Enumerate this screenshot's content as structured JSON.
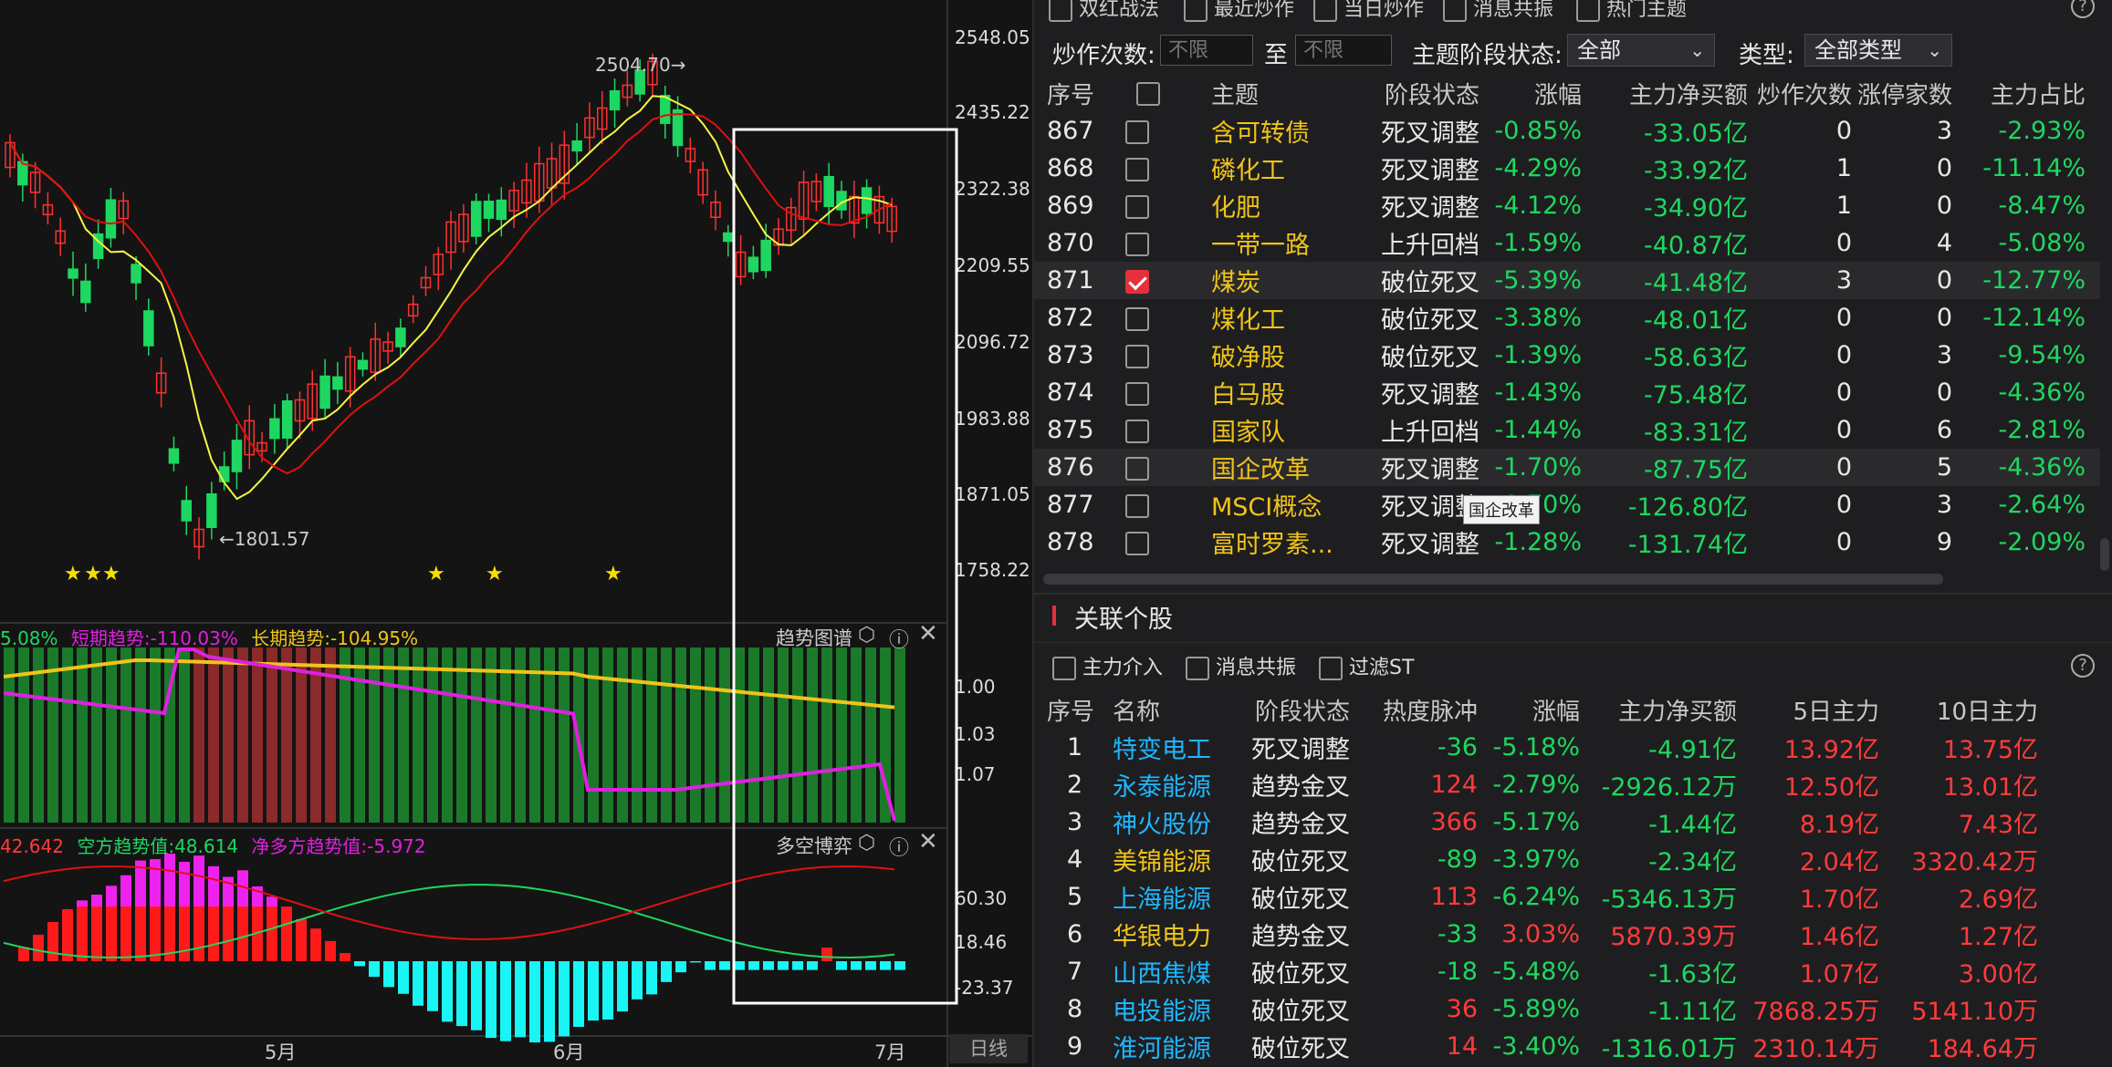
{
  "kchart": {
    "price_labels": [
      "2548.05",
      "2435.22",
      "2322.38",
      "2209.55",
      "2096.72",
      "1983.88",
      "1871.05",
      "1758.22"
    ],
    "high_annot": "2504.70",
    "low_annot": "1801.57",
    "month_labels": [
      "5月",
      "6月",
      "7月"
    ],
    "period_button": "日线"
  },
  "trend_panel": {
    "title": "趋势图谱",
    "legend_a": "5.08%",
    "legend_b": "短期趋势:-110.03%",
    "legend_c": "长期趋势:-104.95%",
    "axis_labels": [
      "1.00",
      "1.03",
      "1.07"
    ],
    "colors": {
      "short": "#e020e0",
      "long": "#f0c419",
      "bull": "#1b7a2a",
      "bear": "#8a2a2a"
    }
  },
  "bull_bear_panel": {
    "title": "多空博弈",
    "legend_a": "42.642",
    "legend_b": "空方趋势值:48.614",
    "legend_c": "净多方趋势值:-5.972",
    "axis_labels": [
      "60.30",
      "18.46",
      "-23.37"
    ]
  },
  "filters": {
    "top_items": [
      "双红战法",
      "最近炒作",
      "当日炒作",
      "消息共振",
      "热门主题"
    ],
    "count_label": "炒作次数:",
    "placeholder_from": "不限",
    "to_label": "至",
    "placeholder_to": "不限",
    "stage_label": "主题阶段状态:",
    "stage_value": "全部",
    "type_label": "类型:",
    "type_value": "全部类型"
  },
  "themes": {
    "headers": [
      "序号",
      "主题",
      "阶段状态",
      "涨幅",
      "主力净买额",
      "炒作次数",
      "涨停家数",
      "主力占比"
    ],
    "rows": [
      {
        "no": "867",
        "name": "含可转债",
        "stage": "死叉调整",
        "chg": "-0.85%",
        "net": "-33.05亿",
        "count": "0",
        "limit": "3",
        "ratio": "-2.93%",
        "checked": false
      },
      {
        "no": "868",
        "name": "磷化工",
        "stage": "死叉调整",
        "chg": "-4.29%",
        "net": "-33.92亿",
        "count": "1",
        "limit": "0",
        "ratio": "-11.14%",
        "checked": false
      },
      {
        "no": "869",
        "name": "化肥",
        "stage": "死叉调整",
        "chg": "-4.12%",
        "net": "-34.90亿",
        "count": "1",
        "limit": "0",
        "ratio": "-8.47%",
        "checked": false
      },
      {
        "no": "870",
        "name": "一带一路",
        "stage": "上升回档",
        "chg": "-1.59%",
        "net": "-40.87亿",
        "count": "0",
        "limit": "4",
        "ratio": "-5.08%",
        "checked": false
      },
      {
        "no": "871",
        "name": "煤炭",
        "stage": "破位死叉",
        "chg": "-5.39%",
        "net": "-41.48亿",
        "count": "3",
        "limit": "0",
        "ratio": "-12.77%",
        "checked": true
      },
      {
        "no": "872",
        "name": "煤化工",
        "stage": "破位死叉",
        "chg": "-3.38%",
        "net": "-48.01亿",
        "count": "0",
        "limit": "0",
        "ratio": "-12.14%",
        "checked": false
      },
      {
        "no": "873",
        "name": "破净股",
        "stage": "破位死叉",
        "chg": "-1.39%",
        "net": "-58.63亿",
        "count": "0",
        "limit": "3",
        "ratio": "-9.54%",
        "checked": false
      },
      {
        "no": "874",
        "name": "白马股",
        "stage": "死叉调整",
        "chg": "-1.43%",
        "net": "-75.48亿",
        "count": "0",
        "limit": "0",
        "ratio": "-4.36%",
        "checked": false
      },
      {
        "no": "875",
        "name": "国家队",
        "stage": "上升回档",
        "chg": "-1.44%",
        "net": "-83.31亿",
        "count": "0",
        "limit": "6",
        "ratio": "-2.81%",
        "checked": false
      },
      {
        "no": "876",
        "name": "国企改革",
        "stage": "死叉调整",
        "chg": "-1.70%",
        "net": "-87.75亿",
        "count": "0",
        "limit": "5",
        "ratio": "-4.36%",
        "checked": false
      },
      {
        "no": "877",
        "name": "MSCI概念",
        "stage": "死叉调整",
        "chg": "-1.70%",
        "net": "-126.80亿",
        "count": "0",
        "limit": "3",
        "ratio": "-2.64%",
        "checked": false
      },
      {
        "no": "878",
        "name": "富时罗素...",
        "stage": "死叉调整",
        "chg": "-1.28%",
        "net": "-131.74亿",
        "count": "0",
        "limit": "9",
        "ratio": "-2.09%",
        "checked": false
      }
    ],
    "tooltip": "国企改革"
  },
  "stocks": {
    "title": "关联个股",
    "filters": [
      "主力介入",
      "消息共振",
      "过滤ST"
    ],
    "headers": [
      "序号",
      "名称",
      "阶段状态",
      "热度脉冲",
      "涨幅",
      "主力净买额",
      "5日主力",
      "10日主力"
    ],
    "rows": [
      {
        "no": "1",
        "name": "特变电工",
        "stage": "死叉调整",
        "heat": "-36",
        "chg": "-5.18%",
        "net": "-4.91亿",
        "d5": "13.92亿",
        "d10": "13.75亿",
        "cyan": true
      },
      {
        "no": "2",
        "name": "永泰能源",
        "stage": "趋势金叉",
        "heat": "124",
        "chg": "-2.79%",
        "net": "-2926.12万",
        "d5": "12.50亿",
        "d10": "13.01亿",
        "cyan": true
      },
      {
        "no": "3",
        "name": "神火股份",
        "stage": "趋势金叉",
        "heat": "366",
        "chg": "-5.17%",
        "net": "-1.44亿",
        "d5": "8.19亿",
        "d10": "7.43亿",
        "cyan": true
      },
      {
        "no": "4",
        "name": "美锦能源",
        "stage": "破位死叉",
        "heat": "-89",
        "chg": "-3.97%",
        "net": "-2.34亿",
        "d5": "2.04亿",
        "d10": "3320.42万",
        "cyan": false
      },
      {
        "no": "5",
        "name": "上海能源",
        "stage": "破位死叉",
        "heat": "113",
        "chg": "-6.24%",
        "net": "-5346.13万",
        "d5": "1.70亿",
        "d10": "2.69亿",
        "cyan": true
      },
      {
        "no": "6",
        "name": "华银电力",
        "stage": "趋势金叉",
        "heat": "-33",
        "chg": "3.03%",
        "net": "5870.39万",
        "d5": "1.46亿",
        "d10": "1.27亿",
        "cyan": false
      },
      {
        "no": "7",
        "name": "山西焦煤",
        "stage": "破位死叉",
        "heat": "-18",
        "chg": "-5.48%",
        "net": "-1.63亿",
        "d5": "1.07亿",
        "d10": "3.00亿",
        "cyan": true
      },
      {
        "no": "8",
        "name": "电投能源",
        "stage": "破位死叉",
        "heat": "36",
        "chg": "-5.89%",
        "net": "-1.11亿",
        "d5": "7868.25万",
        "d10": "5141.10万",
        "cyan": true
      },
      {
        "no": "9",
        "name": "淮河能源",
        "stage": "破位死叉",
        "heat": "14",
        "chg": "-3.40%",
        "net": "-1316.01万",
        "d5": "2310.14万",
        "d10": "184.64万",
        "cyan": true
      }
    ]
  }
}
